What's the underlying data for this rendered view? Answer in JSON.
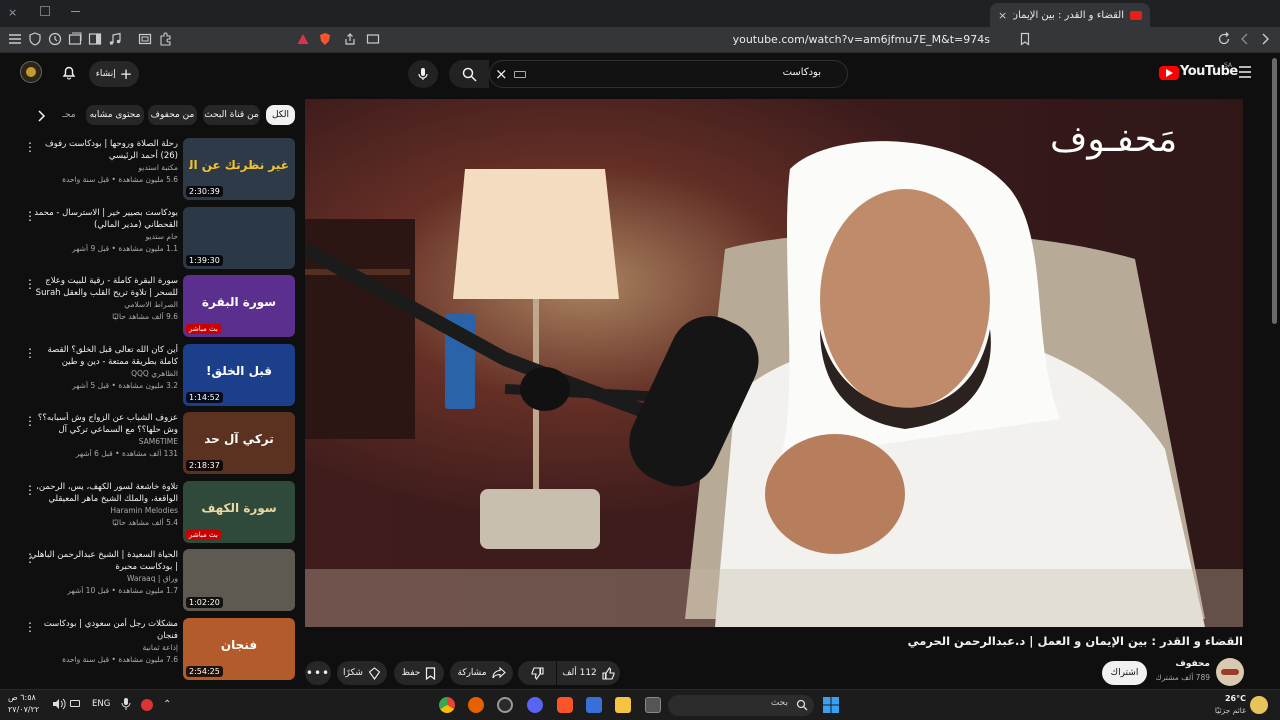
{
  "browser": {
    "tab_title": "القضاء و القدر : بين الإيمان و الـ",
    "url": "youtube.com/watch?v=am6jfmu7E_M&t=974s"
  },
  "header": {
    "logo": "YouTube",
    "country": "SA",
    "search_value": "بودكاست",
    "create_label": "إنشاء"
  },
  "chips": [
    "الكل",
    "من قناة البحث",
    "من محفوف",
    "محتوى مشابه",
    "محـ"
  ],
  "recommendations": [
    {
      "title": "رحلة الصلاة وروحها | بودكاست رفوف (26) أحمد الرئيسي",
      "channel": "مكتبة استديو",
      "meta": "5.6 مليون مشاهدة • قبل سنة واحدة",
      "duration": "2:30:39",
      "thumb_text": "غير نظرتك عن الصلاة",
      "thumb_bg": "#2e3a47",
      "thumb_fg": "#f2c230"
    },
    {
      "title": "بودكاست بصيير خير | الاسترسال - محمد القحطاني (مدير المالي)",
      "channel": "حام ستديو",
      "meta": "1.1 مليون مشاهدة • قبل 9 أشهر",
      "duration": "1:39:30",
      "thumb_text": "",
      "thumb_bg": "#2b3845",
      "thumb_fg": "#ffffff"
    },
    {
      "title": "سورة البقرة كاملة - رقية للبيت وعلاج للسحر | تلاوة تريح القلب والعقل Surah Al-...",
      "channel": "الصراط الاسلامي",
      "meta": "9.6 ألف مشاهد حاليًا",
      "duration": "",
      "thumb_text": "سورة البقرة",
      "thumb_bg": "#5a2f8e",
      "thumb_fg": "#ffffff"
    },
    {
      "title": "أين كان الله تعالى قبل الخلق؟ القصة كاملة بطريقة ممتعة - دين و طين",
      "channel": "الظاهري QQQ",
      "meta": "3.2 مليون مشاهدة • قبل 5 أشهر",
      "duration": "1:14:52",
      "thumb_text": "قبل الخلق!",
      "thumb_bg": "#1b3f8a",
      "thumb_fg": "#ffffff"
    },
    {
      "title": "عزوف الشباب عن الزواج وش أسبابه؟؟ وش حلها؟؟ مع السماعي تركي آل خصوصية في ...",
      "channel": "SAM6TIME",
      "meta": "131 ألف مشاهدة • قبل 6 أشهر",
      "duration": "2:18:37",
      "thumb_text": "تركي آل حد",
      "thumb_bg": "#5b3120",
      "thumb_fg": "#ffffff"
    },
    {
      "title": "تلاوة خاشعة لسور الكهف، يس، الرحمن، الواقعة، والملك الشيخ ماهر المعيقلي لتيسير ...",
      "channel": "Haramin Melodies",
      "meta": "5.4 ألف مشاهد حاليًا",
      "duration": "",
      "thumb_text": "سورة الكهف",
      "thumb_bg": "#2f4a3a",
      "thumb_fg": "#e9d9a0"
    },
    {
      "title": "الحياة السعيدة | الشيخ عبدالرحمن الباهلي | بودكاست محبرة",
      "channel": "وراق | Waraaq",
      "meta": "1.7 مليون مشاهدة • قبل 10 أشهر",
      "duration": "1:02:20",
      "thumb_text": "",
      "thumb_bg": "#5e5a52",
      "thumb_fg": "#ffffff"
    },
    {
      "title": "مشكلات رجل أمن سعودي | بودكاست فنجان",
      "channel": "إذاعة ثمانية",
      "meta": "7.6 مليون مشاهدة • قبل سنة واحدة",
      "duration": "2:54:25",
      "thumb_text": "فنجان",
      "thumb_bg": "#b35b2a",
      "thumb_fg": "#ffffff"
    }
  ],
  "live_badge": "بث مباشر",
  "video": {
    "watermark": "مَحفـوف",
    "title": "القضاء و القدر : بين الإيمان و العمل | د.عبدالرحمن الحرمي",
    "channel": "محفوف",
    "subscribers": "789 ألف مشترك",
    "subscribe_label": "اشتراك",
    "likes": "112 ألف",
    "share_label": "مشاركة",
    "save_label": "حفظ",
    "thanks_label": "شكرًا"
  },
  "taskbar": {
    "weather_temp": "26°C",
    "weather_text": "غائم جزئيًا",
    "search_placeholder": "بحث",
    "lang": "ENG",
    "time": "٦:٥٨ ص",
    "date": "٢٧/٠٧/٢٢"
  }
}
